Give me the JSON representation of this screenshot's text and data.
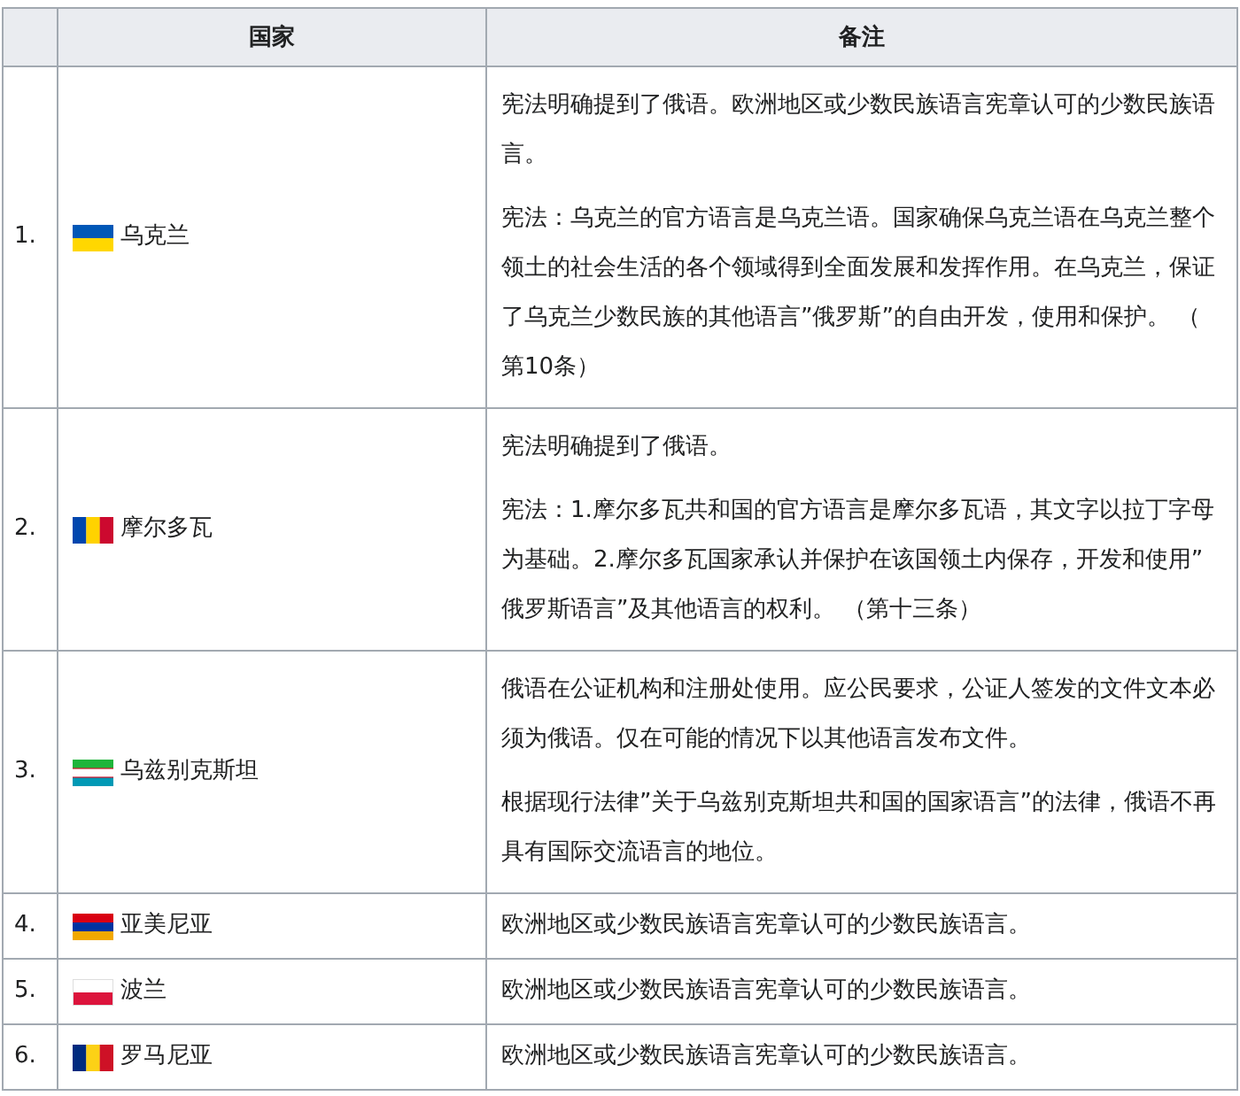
{
  "table": {
    "columns": [
      "国家",
      "备注"
    ],
    "rows": [
      {
        "number": "1.",
        "country": "乌克兰",
        "notes": [
          "宪法明确提到了俄语。欧洲地区或少数民族语言宪章认可的少数民族语言。",
          "宪法：乌克兰的官方语言是乌克兰语。国家确保乌克兰语在乌克兰整个领土的社会生活的各个领域得到全面发展和发挥作用。在乌克兰，保证了乌克兰少数民族的其他语言”俄罗斯”的自由开发，使用和保护。 （第10条）"
        ]
      },
      {
        "number": "2.",
        "country": "摩尔多瓦",
        "notes": [
          "宪法明确提到了俄语。",
          "宪法：1.摩尔多瓦共和国的官方语言是摩尔多瓦语，其文字以拉丁字母为基础。2.摩尔多瓦国家承认并保护在该国领土内保存，开发和使用”俄罗斯语言”及其他语言的权利。 （第十三条）"
        ]
      },
      {
        "number": "3.",
        "country": "乌兹别克斯坦",
        "notes": [
          "俄语在公证机构和注册处使用。应公民要求，公证人签发的文件文本必须为俄语。仅在可能的情况下以其他语言发布文件。",
          "根据现行法律”关于乌兹别克斯坦共和国的国家语言”的法律，俄语不再具有国际交流语言的地位。"
        ]
      },
      {
        "number": "4.",
        "country": "亚美尼亚",
        "notes": [
          "欧洲地区或少数民族语言宪章认可的少数民族语言。"
        ]
      },
      {
        "number": "5.",
        "country": "波兰",
        "notes": [
          "欧洲地区或少数民族语言宪章认可的少数民族语言。"
        ]
      },
      {
        "number": "6.",
        "country": "罗马尼亚",
        "notes": [
          "欧洲地区或少数民族语言宪章认可的少数民族语言。"
        ]
      }
    ]
  }
}
